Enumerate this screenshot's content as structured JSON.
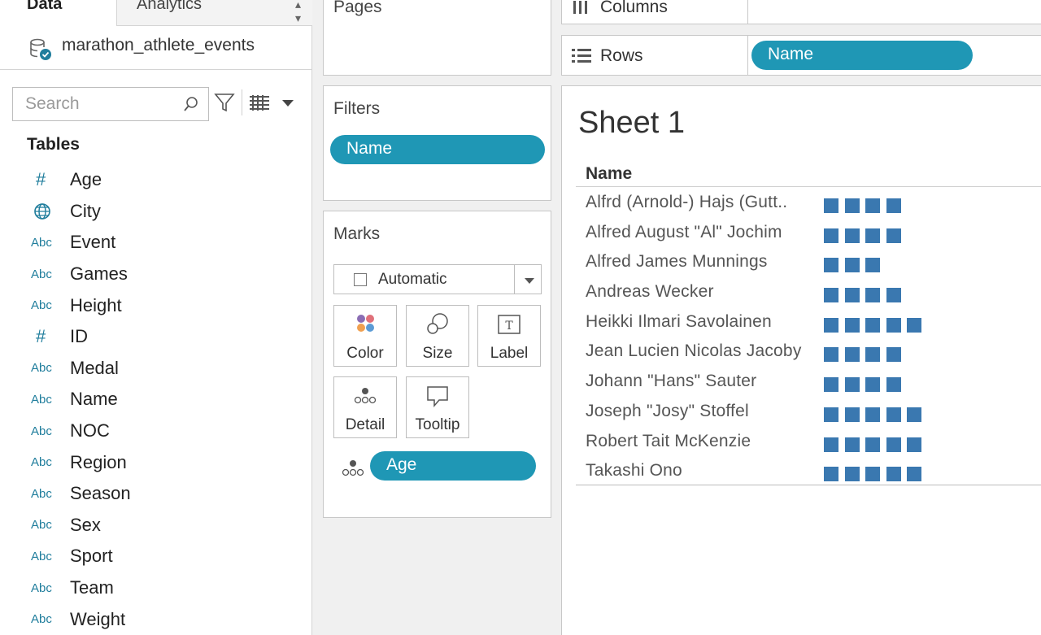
{
  "data_pane": {
    "tab_data": "Data",
    "tab_analytics": "Analytics",
    "data_source": "marathon_athlete_events",
    "search_placeholder": "Search",
    "tables_heading": "Tables",
    "fields": [
      {
        "type": "#",
        "name": "Age"
      },
      {
        "type": "globe",
        "name": "City"
      },
      {
        "type": "Abc",
        "name": "Event"
      },
      {
        "type": "Abc",
        "name": "Games"
      },
      {
        "type": "Abc",
        "name": "Height"
      },
      {
        "type": "#",
        "name": "ID"
      },
      {
        "type": "Abc",
        "name": "Medal"
      },
      {
        "type": "Abc",
        "name": "Name"
      },
      {
        "type": "Abc",
        "name": "NOC"
      },
      {
        "type": "Abc",
        "name": "Region"
      },
      {
        "type": "Abc",
        "name": "Season"
      },
      {
        "type": "Abc",
        "name": "Sex"
      },
      {
        "type": "Abc",
        "name": "Sport"
      },
      {
        "type": "Abc",
        "name": "Team"
      },
      {
        "type": "Abc",
        "name": "Weight"
      }
    ]
  },
  "shelves": {
    "pages_title": "Pages",
    "filters_title": "Filters",
    "filter_pill": "Name",
    "marks_title": "Marks",
    "mark_type": "Automatic",
    "mark_buttons": {
      "color": "Color",
      "size": "Size",
      "label": "Label",
      "detail": "Detail",
      "tooltip": "Tooltip"
    },
    "age_pill": "Age",
    "columns_label": "Columns",
    "rows_label": "Rows",
    "rows_pill": "Name"
  },
  "view": {
    "sheet_title": "Sheet 1",
    "column_header": "Name",
    "rows": [
      {
        "name": "Alfrd (Arnold-) Hajs (Gutt..",
        "marks": 4
      },
      {
        "name": "Alfred August \"Al\" Jochim",
        "marks": 4
      },
      {
        "name": "Alfred James Munnings",
        "marks": 3
      },
      {
        "name": "Andreas Wecker",
        "marks": 4
      },
      {
        "name": "Heikki Ilmari Savolainen",
        "marks": 5
      },
      {
        "name": "Jean Lucien Nicolas Jacoby",
        "marks": 4
      },
      {
        "name": "Johann \"Hans\" Sauter",
        "marks": 4
      },
      {
        "name": "Joseph \"Josy\" Stoffel",
        "marks": 5
      },
      {
        "name": "Robert Tait McKenzie",
        "marks": 5
      },
      {
        "name": "Takashi Ono",
        "marks": 5
      }
    ]
  },
  "colors": {
    "pill": "#1f97b5",
    "mark_square": "#3a78b0",
    "field_type": "#1f7d9c"
  }
}
